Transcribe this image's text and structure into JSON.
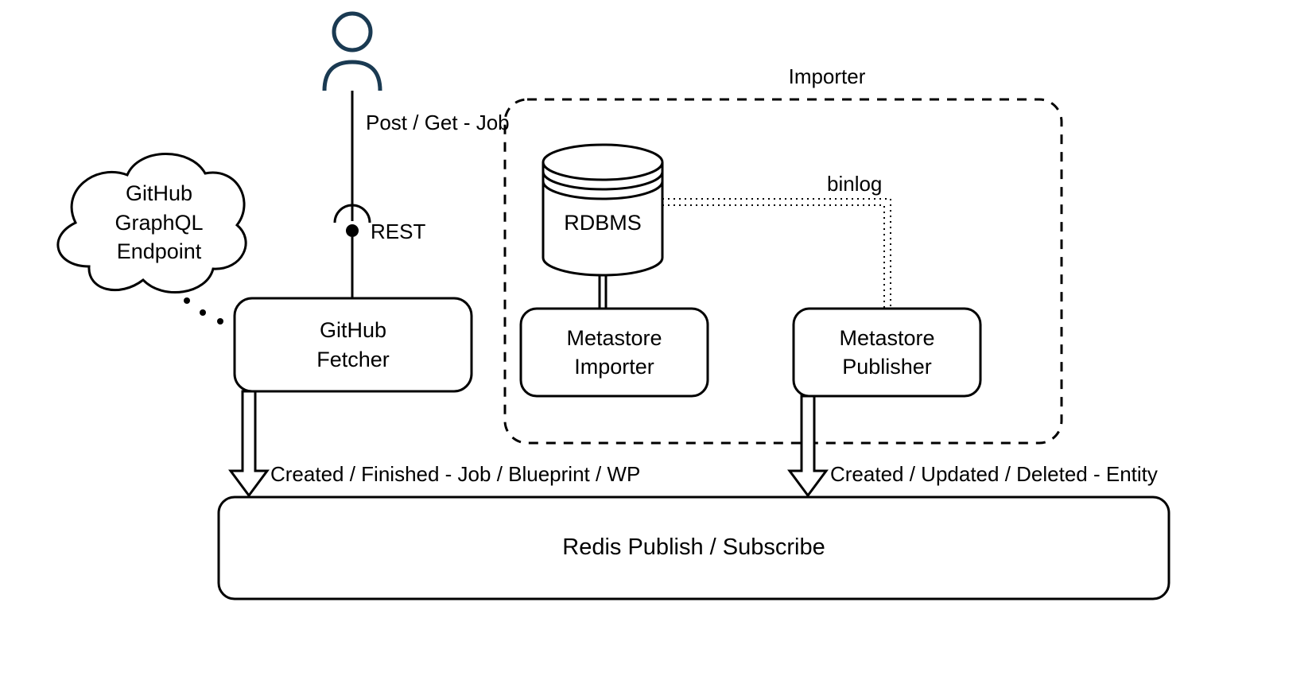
{
  "user_icon_label": "",
  "edge_user_to_fetcher": "Post / Get - Job",
  "rest_label": "REST",
  "cloud_lines": [
    "GitHub",
    "GraphQL",
    "Endpoint"
  ],
  "fetcher_box": "GitHub\nFetcher",
  "rdbms_label": "RDBMS",
  "importer_box": "Metastore\nImporter",
  "publisher_box": "Metastore\nPublisher",
  "importer_group_label": "Importer",
  "binlog_label": "binlog",
  "edge_fetcher_to_redis": "Created / Finished - Job / Blueprint / WP",
  "edge_publisher_to_redis": "Created / Updated / Deleted - Entity",
  "redis_box": "Redis Publish / Subscribe"
}
